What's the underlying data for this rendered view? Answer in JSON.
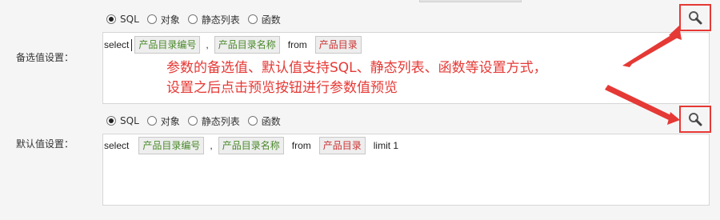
{
  "radio_options": [
    "SQL",
    "对象",
    "静态列表",
    "函数"
  ],
  "selected_option": "SQL",
  "candidate": {
    "label": "备选值设置：",
    "sql": {
      "select_kw": "select",
      "field1": "产品目录编号",
      "comma": ",",
      "field2": "产品目录名称",
      "from_kw": "from",
      "table": "产品目录"
    }
  },
  "default": {
    "label": "默认值设置：",
    "sql": {
      "select_kw": "select",
      "field1": "产品目录编号",
      "comma": ",",
      "field2": "产品目录名称",
      "from_kw": "from",
      "table": "产品目录",
      "limit": "limit 1"
    }
  },
  "annotation": {
    "line1": "参数的备选值、默认值支持SQL、静态列表、函数等设置方式，",
    "line2": "设置之后点击预览按钮进行参数值预览"
  },
  "colors": {
    "annotation": "#e53935",
    "field_tag": "#4a8a2a",
    "table_tag": "#cc3333"
  },
  "icons": {
    "preview": "magnifier-icon"
  }
}
